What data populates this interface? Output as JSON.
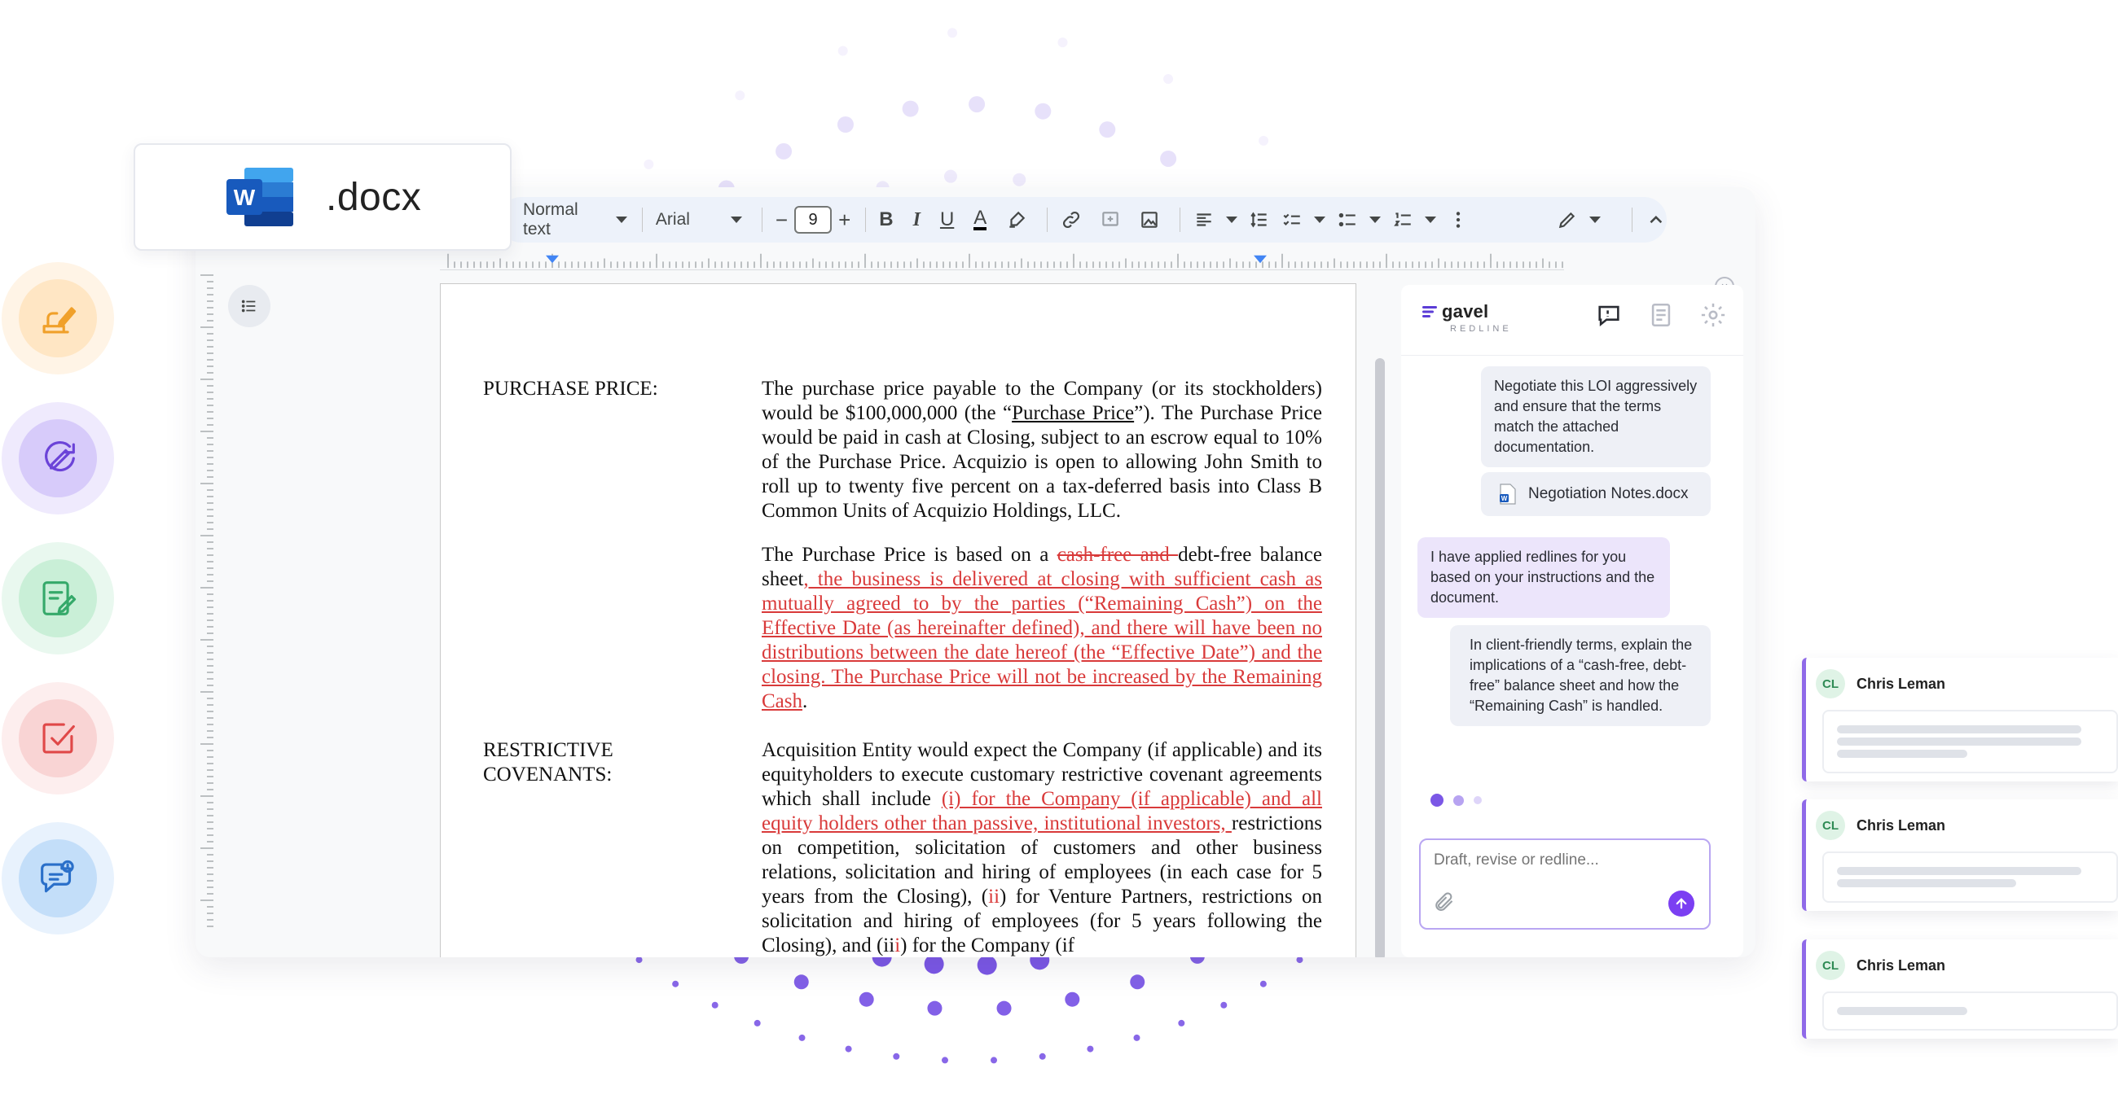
{
  "badge": {
    "extension": ".docx",
    "icon": "word-icon"
  },
  "toolbar": {
    "style": "Normal text",
    "font": "Arial",
    "font_size": "9",
    "minus": "−",
    "plus": "+",
    "bold": "B",
    "italic": "I",
    "underline": "U",
    "text_color": "A"
  },
  "document": {
    "purchase_label": "PURCHASE PRICE:",
    "purchase_p1_a": "The purchase price payable to the Company (or its stockholders) would be $100,000,000 (the “",
    "purchase_p1_term": "Purchase Price",
    "purchase_p1_b": "”). The Purchase Price would be paid in cash at Closing, subject to an escrow equal to 10% of the Purchase Price. Acquizio is open to allowing John Smith to roll up to twenty five percent on a tax-deferred basis into Class B Common Units of Acquizio Holdings, LLC.",
    "purchase_p2_a": "The Purchase Price is based on a ",
    "purchase_p2_strike": "cash-free and ",
    "purchase_p2_b": "debt-free balance sheet",
    "purchase_p2_red": ", the business is delivered at closing with sufficient cash as mutually agreed to by the parties (“Remaining Cash”) on the Effective Date (as hereinafter defined), and there will have been no distributions between the date hereof (the “Effective Date”) and the closing. The Purchase Price will not be increased by the Remaining Cash",
    "purchase_p2_end": ".",
    "restrictive_label_1": "RESTRICTIVE",
    "restrictive_label_2": "COVENANTS:",
    "restrictive_a": "Acquisition Entity would expect the Company (if applicable) and its equityholders to execute customary restrictive covenant agreements which shall include ",
    "restrictive_red": "(i) for the Company (if applicable) and all equity holders other than passive, institutional investors, ",
    "restrictive_b": "restrictions on competition, solicitation of customers and other business relations, solicitation and hiring of employees (in each case for 5 years from the Closing), (",
    "restrictive_ii": "ii",
    "restrictive_c": ") for Venture Partners, restrictions on solicitation and hiring of employees (for 5 years following the Closing), and (ii",
    "restrictive_i": "i",
    "restrictive_d": ") for the Company (if"
  },
  "panel": {
    "brand": "gavel",
    "brand_sub": "REDLINE",
    "msg_user_1": "Negotiate this LOI aggressively and ensure that the terms match the attached documentation.",
    "attachment": "Negotiation Notes.docx",
    "msg_bot_1": "I have applied redlines for you based on your instructions and the document.",
    "msg_user_2": "In client-friendly terms, explain the implications of a “cash-free, debt-free” balance sheet  and how the “Remaining Cash” is handled.",
    "composer_placeholder": "Draft, revise or redline..."
  },
  "comments": [
    {
      "initials": "CL",
      "name": "Chris Leman"
    },
    {
      "initials": "CL",
      "name": "Chris Leman"
    },
    {
      "initials": "CL",
      "name": "Chris Leman"
    }
  ],
  "colors": {
    "accent": "#7b3ff2",
    "redline": "#d93a3a",
    "dots": "#7b57e6"
  }
}
